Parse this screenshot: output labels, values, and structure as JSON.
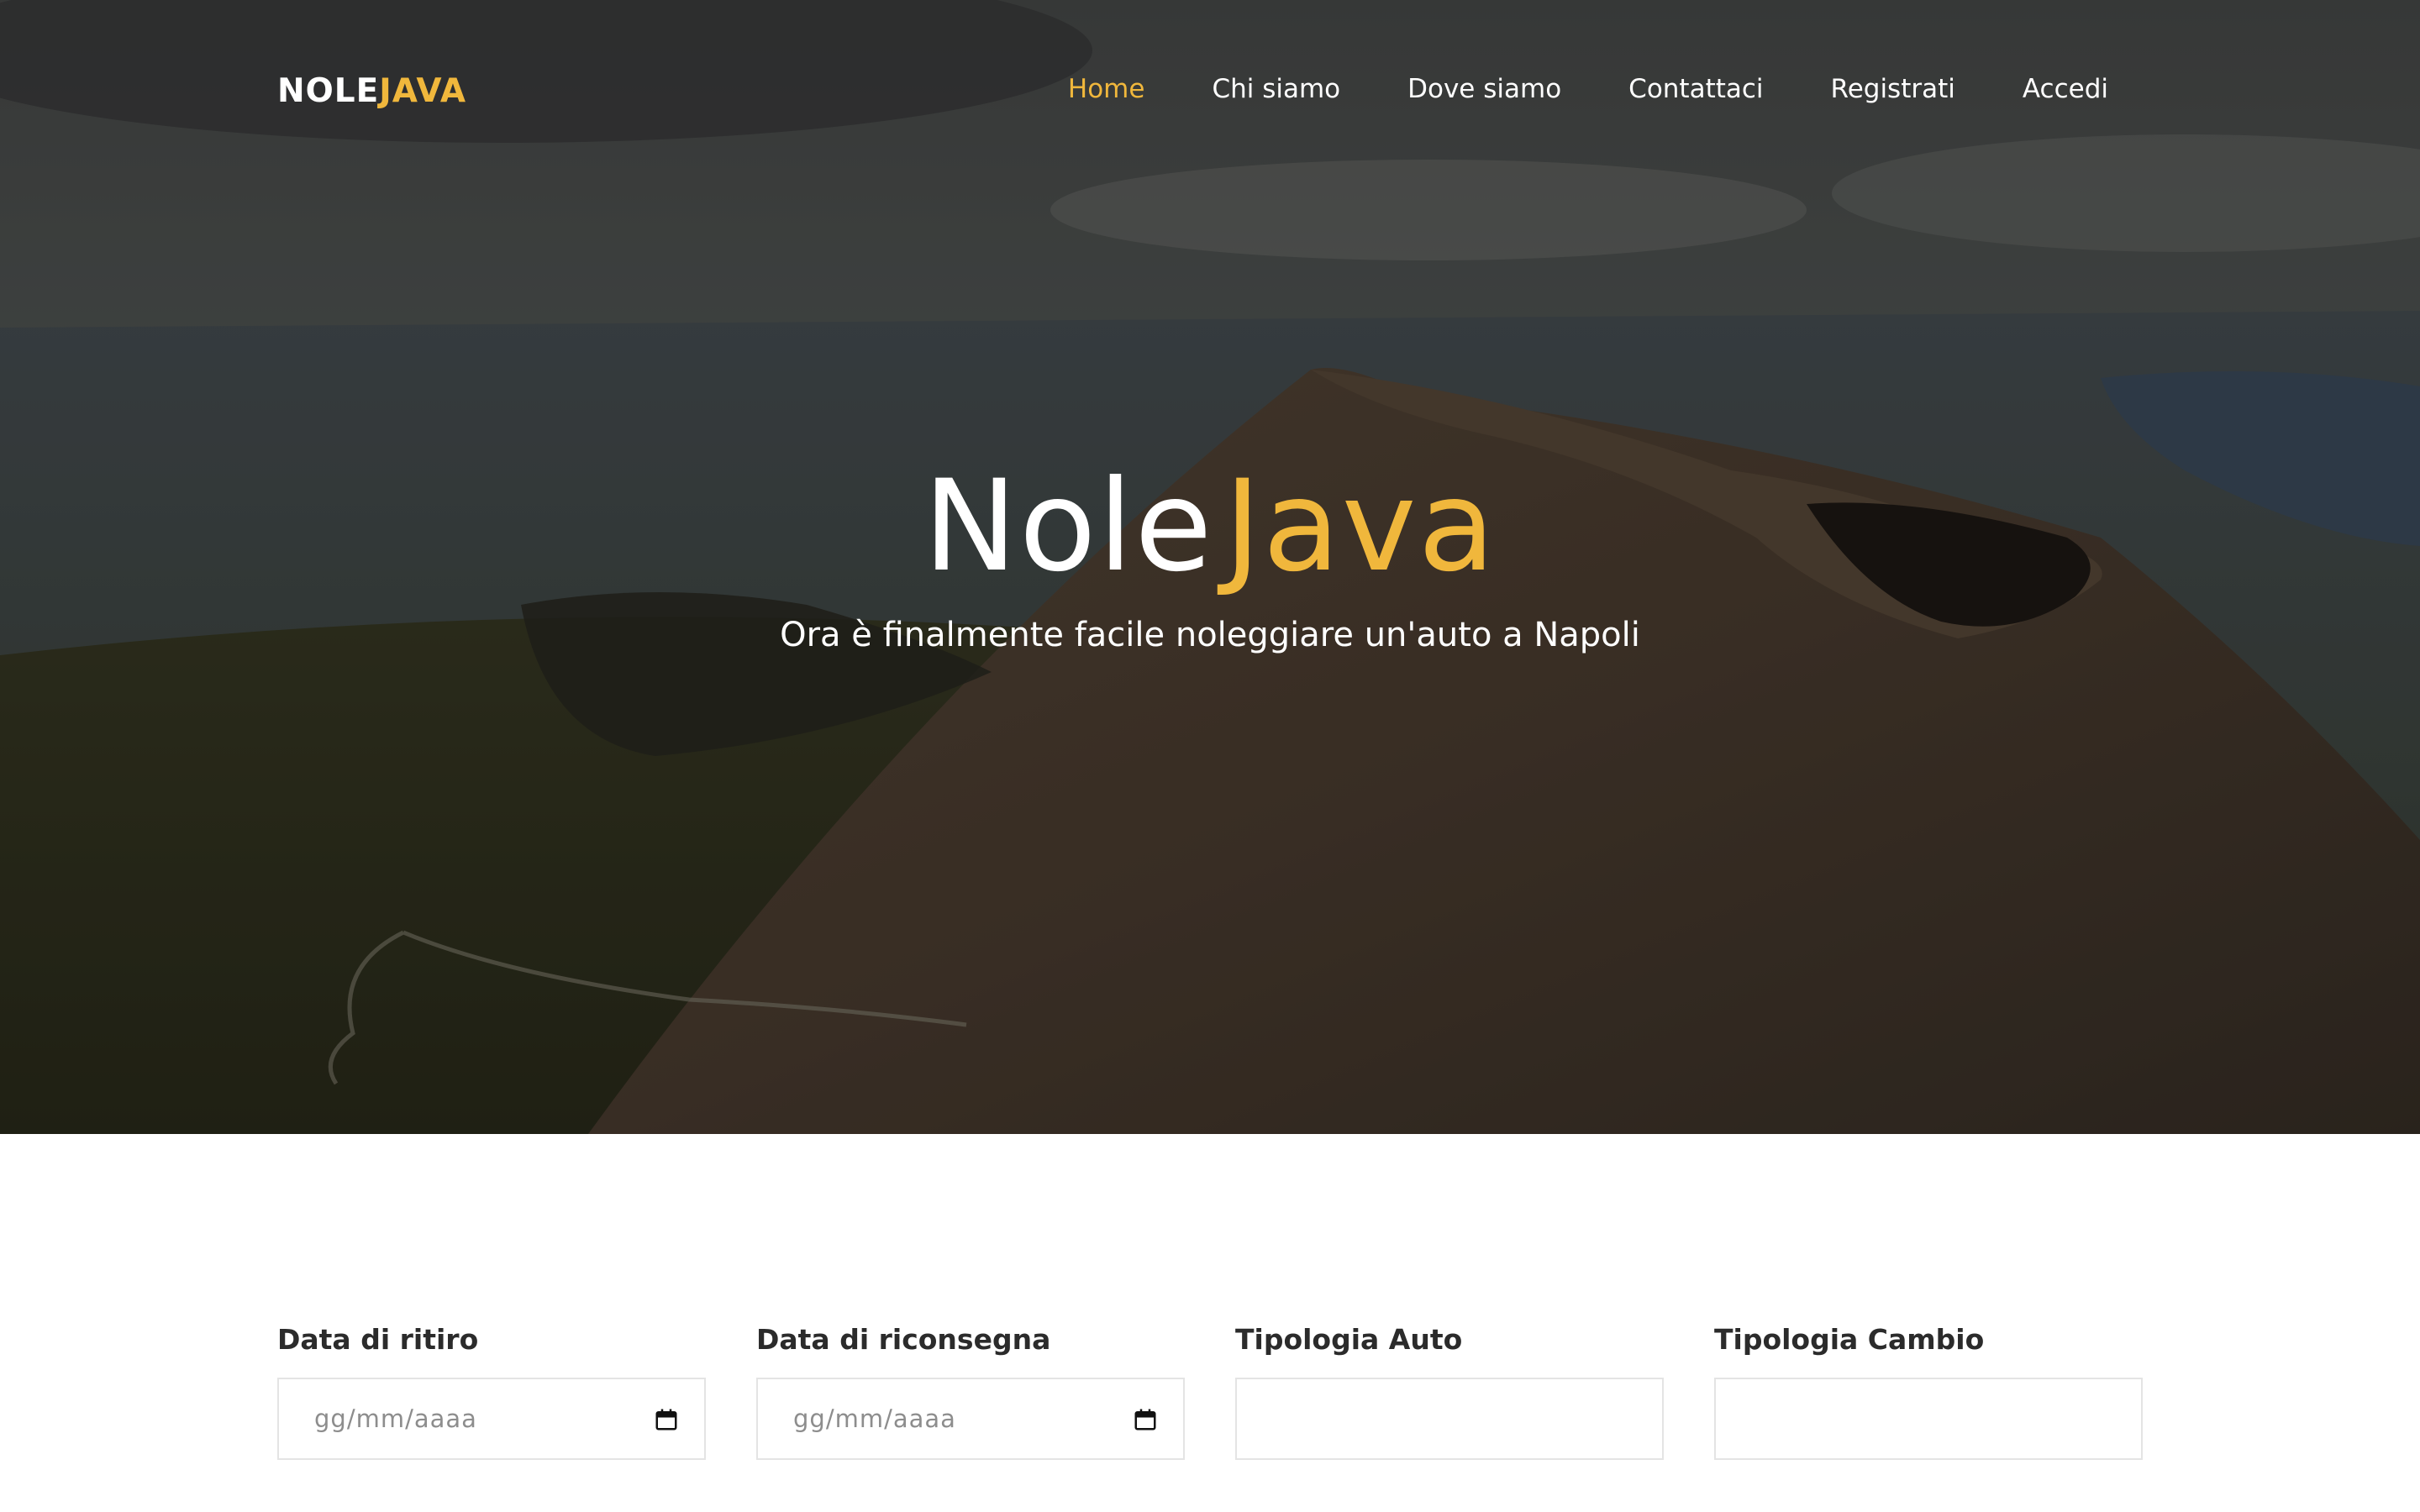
{
  "brand": {
    "logo_part1": "NOLE",
    "logo_part2": "JAVA"
  },
  "nav": {
    "items": [
      {
        "label": "Home",
        "active": true
      },
      {
        "label": "Chi siamo"
      },
      {
        "label": "Dove siamo"
      },
      {
        "label": "Contattaci"
      },
      {
        "label": "Registrati"
      },
      {
        "label": "Accedi"
      }
    ]
  },
  "hero": {
    "title_part1": "Nole",
    "title_part2": "Java",
    "subtitle": "Ora è finalmente facile noleggiare un'auto a Napoli",
    "background": "aerial-volcano-photo"
  },
  "booking": {
    "pickup_label": "Data di ritiro",
    "pickup_placeholder": "gg/mm/aaaa",
    "return_label": "Data di riconsegna",
    "return_placeholder": "gg/mm/aaaa",
    "car_type_label": "Tipologia Auto",
    "car_type_value": "",
    "transmission_label": "Tipologia Cambio",
    "transmission_value": ""
  },
  "colors": {
    "accent": "#f0b73c",
    "text_dark": "#2b2b2b",
    "input_border": "#e4e4e4"
  }
}
